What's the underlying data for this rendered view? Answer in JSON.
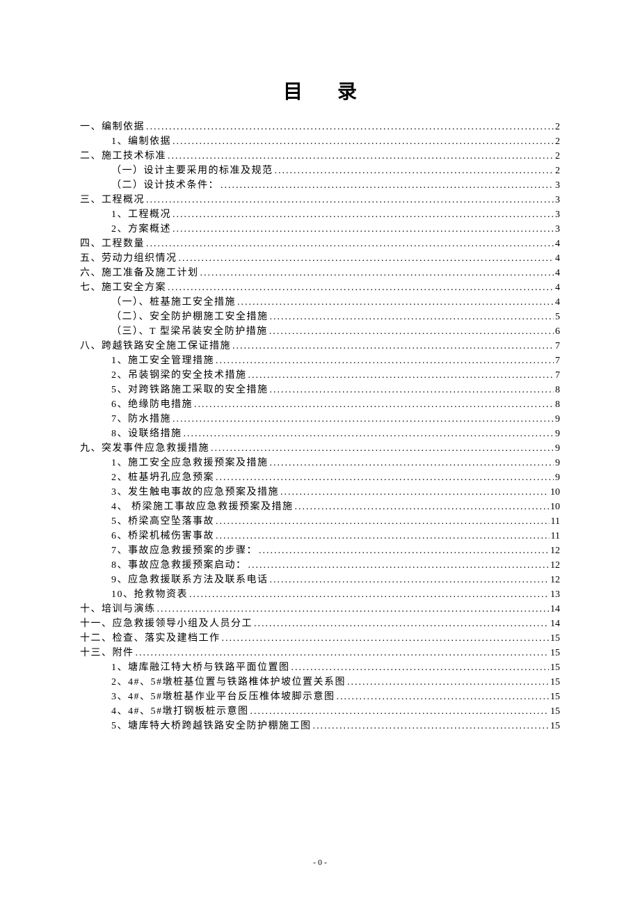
{
  "title": "目录",
  "footer": "- 0 -",
  "toc": [
    {
      "level": 1,
      "text": "一、编制依据",
      "page": "2"
    },
    {
      "level": 2,
      "text": "1、编制依据",
      "page": "2"
    },
    {
      "level": 1,
      "text": "二、施工技术标准",
      "page": "2"
    },
    {
      "level": 2,
      "text": "（一）设计主要采用的标准及规范",
      "page": "2"
    },
    {
      "level": 2,
      "text": "（二）设计技术条件：",
      "page": "3"
    },
    {
      "level": 1,
      "text": "三、工程概况",
      "page": "3"
    },
    {
      "level": 2,
      "text": "1、工程概况",
      "page": "3"
    },
    {
      "level": 2,
      "text": "2、方案概述",
      "page": "3"
    },
    {
      "level": 1,
      "text": "四、工程数量",
      "page": "4"
    },
    {
      "level": 1,
      "text": "五、劳动力组织情况",
      "page": "4"
    },
    {
      "level": 1,
      "text": "六、施工准备及施工计划",
      "page": "4"
    },
    {
      "level": 1,
      "text": "七、施工安全方案",
      "page": "4"
    },
    {
      "level": 2,
      "text": "（一）、桩基施工安全措施",
      "page": "4"
    },
    {
      "level": 2,
      "text": "（二）、安全防护棚施工安全措施",
      "page": "5"
    },
    {
      "level": 2,
      "text": "（三）、T 型梁吊装安全防护措施",
      "page": "6"
    },
    {
      "level": 1,
      "text": "八、跨越铁路安全施工保证措施",
      "page": "7"
    },
    {
      "level": 2,
      "text": "1、施工安全管理措施",
      "page": "7"
    },
    {
      "level": 2,
      "text": "2、吊装钢梁的安全技术措施",
      "page": "7"
    },
    {
      "level": 2,
      "text": "5、对跨铁路施工采取的安全措施",
      "page": "8"
    },
    {
      "level": 2,
      "text": "6、绝缘防电措施",
      "page": "8"
    },
    {
      "level": 2,
      "text": "7、防水措施",
      "page": "9"
    },
    {
      "level": 2,
      "text": "8、设联络措施",
      "page": "9"
    },
    {
      "level": 1,
      "text": "九、突发事件应急救援措施",
      "page": "9"
    },
    {
      "level": 2,
      "text": "1、施工安全应急救援预案及措施",
      "page": "9"
    },
    {
      "level": 2,
      "text": "2、桩基坍孔应急预案",
      "page": "9"
    },
    {
      "level": 2,
      "text": "3、发生触电事故的应急预案及措施",
      "page": "10"
    },
    {
      "level": 2,
      "text": "4、 桥梁施工事故应急救援预案及措施",
      "page": "10"
    },
    {
      "level": 2,
      "text": "5、桥梁高空坠落事故",
      "page": "11"
    },
    {
      "level": 2,
      "text": "6、桥梁机械伤害事故",
      "page": "11"
    },
    {
      "level": 2,
      "text": "7、事故应急救援预案的步骤：",
      "page": "12"
    },
    {
      "level": 2,
      "text": "8、事故应急救援预案启动：",
      "page": "12"
    },
    {
      "level": 2,
      "text": "9、应急救援联系方法及联系电话",
      "page": "12"
    },
    {
      "level": 2,
      "text": "10、抢救物资表",
      "page": "13"
    },
    {
      "level": 1,
      "text": "十、培训与演练",
      "page": "14"
    },
    {
      "level": 1,
      "text": "十一、应急救援领导小组及人员分工",
      "page": "14"
    },
    {
      "level": 1,
      "text": "十二、检查、落实及建档工作",
      "page": "15"
    },
    {
      "level": 1,
      "text": "十三、附件",
      "page": "15"
    },
    {
      "level": 2,
      "text": "1、塘库融江特大桥与铁路平面位置图",
      "page": "15"
    },
    {
      "level": 2,
      "text": "2、4#、5#墩桩基位置与铁路椎体护坡位置关系图",
      "page": "15"
    },
    {
      "level": 2,
      "text": "3、4#、5#墩桩基作业平台反压椎体坡脚示意图",
      "page": "15"
    },
    {
      "level": 2,
      "text": "4、4#、5#墩打钢板桩示意图",
      "page": "15"
    },
    {
      "level": 2,
      "text": "5、塘库特大桥跨越铁路安全防护棚施工图",
      "page": "15"
    }
  ]
}
